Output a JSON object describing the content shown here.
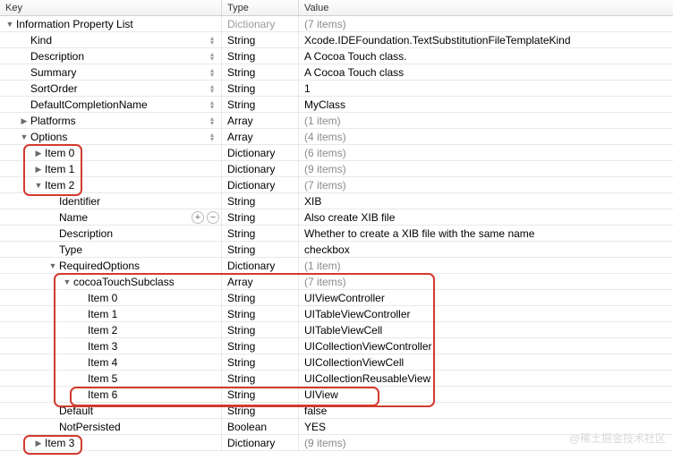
{
  "columns": {
    "key": "Key",
    "type": "Type",
    "value": "Value"
  },
  "rows": [
    {
      "i": 0,
      "name": "root",
      "tri": "down",
      "key": "Information Property List",
      "type": "Dictionary",
      "type_dim": true,
      "value": "(7 items)",
      "val_dim": true,
      "sel": false
    },
    {
      "i": 1,
      "name": "kind",
      "tri": "",
      "key": "Kind",
      "type": "String",
      "value": "Xcode.IDEFoundation.TextSubstitutionFileTemplateKind",
      "sel": true
    },
    {
      "i": 1,
      "name": "description",
      "tri": "",
      "key": "Description",
      "type": "String",
      "value": "A Cocoa Touch class.",
      "sel": true
    },
    {
      "i": 1,
      "name": "summary",
      "tri": "",
      "key": "Summary",
      "type": "String",
      "value": "A Cocoa Touch class",
      "sel": true
    },
    {
      "i": 1,
      "name": "sortorder",
      "tri": "",
      "key": "SortOrder",
      "type": "String",
      "value": "1",
      "sel": true
    },
    {
      "i": 1,
      "name": "defaultcompletionname",
      "tri": "",
      "key": "DefaultCompletionName",
      "type": "String",
      "value": "MyClass",
      "sel": true
    },
    {
      "i": 1,
      "name": "platforms",
      "tri": "right",
      "key": "Platforms",
      "type": "Array",
      "value": "(1 item)",
      "val_dim": true,
      "sel": true
    },
    {
      "i": 1,
      "name": "options",
      "tri": "down",
      "key": "Options",
      "type": "Array",
      "value": "(4 items)",
      "val_dim": true,
      "sel": true
    },
    {
      "i": 2,
      "name": "options-item0",
      "tri": "right",
      "key": "Item 0",
      "type": "Dictionary",
      "value": "(6 items)",
      "val_dim": true
    },
    {
      "i": 2,
      "name": "options-item1",
      "tri": "right",
      "key": "Item 1",
      "type": "Dictionary",
      "value": "(9 items)",
      "val_dim": true
    },
    {
      "i": 2,
      "name": "options-item2",
      "tri": "down",
      "key": "Item 2",
      "type": "Dictionary",
      "value": "(7 items)",
      "val_dim": true
    },
    {
      "i": 3,
      "name": "identifier",
      "tri": "",
      "key": "Identifier",
      "type": "String",
      "value": "XIB"
    },
    {
      "i": 3,
      "name": "name",
      "tri": "",
      "key": "Name",
      "type": "String",
      "value": "Also create XIB file",
      "btns": true
    },
    {
      "i": 3,
      "name": "description2",
      "tri": "",
      "key": "Description",
      "type": "String",
      "value": "Whether to create a XIB file with the same name"
    },
    {
      "i": 3,
      "name": "type",
      "tri": "",
      "key": "Type",
      "type": "String",
      "value": "checkbox"
    },
    {
      "i": 3,
      "name": "requiredoptions",
      "tri": "down",
      "key": "RequiredOptions",
      "type": "Dictionary",
      "value": "(1 item)",
      "val_dim": true
    },
    {
      "i": 4,
      "name": "cocoatouchsubclass",
      "tri": "down",
      "key": "cocoaTouchSubclass",
      "type": "Array",
      "value": "(7 items)",
      "val_dim": true
    },
    {
      "i": 5,
      "name": "cts-item0",
      "tri": "",
      "key": "Item 0",
      "type": "String",
      "value": "UIViewController"
    },
    {
      "i": 5,
      "name": "cts-item1",
      "tri": "",
      "key": "Item 1",
      "type": "String",
      "value": "UITableViewController"
    },
    {
      "i": 5,
      "name": "cts-item2",
      "tri": "",
      "key": "Item 2",
      "type": "String",
      "value": "UITableViewCell"
    },
    {
      "i": 5,
      "name": "cts-item3",
      "tri": "",
      "key": "Item 3",
      "type": "String",
      "value": "UICollectionViewController"
    },
    {
      "i": 5,
      "name": "cts-item4",
      "tri": "",
      "key": "Item 4",
      "type": "String",
      "value": "UICollectionViewCell"
    },
    {
      "i": 5,
      "name": "cts-item5",
      "tri": "",
      "key": "Item 5",
      "type": "String",
      "value": "UICollectionReusableView"
    },
    {
      "i": 5,
      "name": "cts-item6",
      "tri": "",
      "key": "Item 6",
      "type": "String",
      "value": "UIView"
    },
    {
      "i": 3,
      "name": "default",
      "tri": "",
      "key": "Default",
      "type": "String",
      "value": "false"
    },
    {
      "i": 3,
      "name": "notpersisted",
      "tri": "",
      "key": "NotPersisted",
      "type": "Boolean",
      "value": "YES"
    },
    {
      "i": 2,
      "name": "options-item3",
      "tri": "right",
      "key": "Item 3",
      "type": "Dictionary",
      "value": "(9 items)",
      "val_dim": true
    }
  ],
  "icons": {
    "plus": "+",
    "minus": "−"
  },
  "watermark": "@稀土掘金技术社区"
}
